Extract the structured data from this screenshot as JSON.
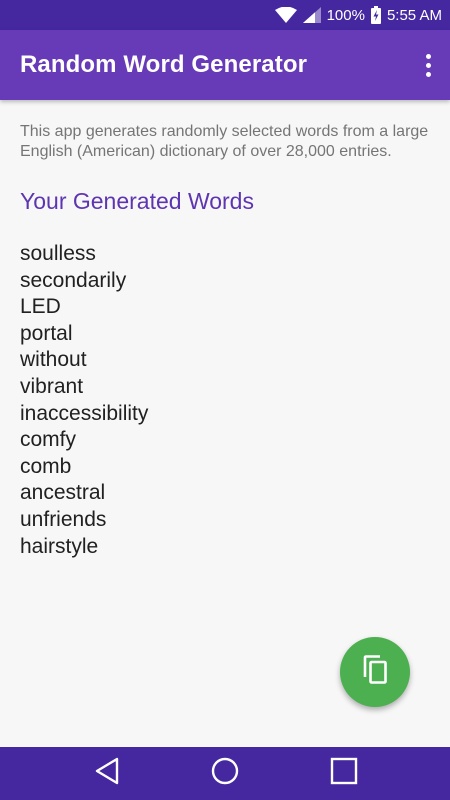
{
  "status_bar": {
    "battery_percent": "100%",
    "time": "5:55 AM",
    "icons": [
      "wifi-icon",
      "cell-signal-icon",
      "battery-charging-icon"
    ]
  },
  "app_bar": {
    "title": "Random Word Generator",
    "menu_icon": "overflow-menu-icon"
  },
  "main": {
    "description": "This app generates randomly selected words from a large English (American) dictionary of over 28,000 entries.",
    "heading": "Your Generated Words",
    "words": [
      "soulless",
      "secondarily",
      "LED",
      "portal",
      "without",
      "vibrant",
      "inaccessibility",
      "comfy",
      "comb",
      "ancestral",
      "unfriends",
      "hairstyle"
    ]
  },
  "fab": {
    "icon": "copy-icon"
  },
  "nav_bar": {
    "icons": [
      "back-icon",
      "home-icon",
      "recents-icon"
    ]
  },
  "colors": {
    "status_bar": "#4527a0",
    "app_bar": "#673ab7",
    "heading": "#5e35b1",
    "fab": "#4caf50",
    "background": "#f7f7f7",
    "nav_bar": "#4527a0"
  }
}
